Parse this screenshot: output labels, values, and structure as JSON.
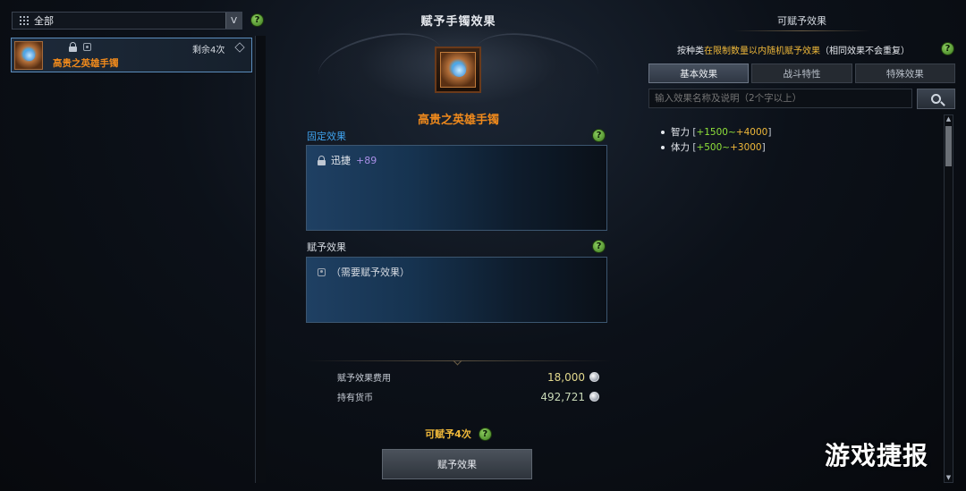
{
  "left": {
    "filter_label": "全部",
    "dropdown_arrow": "V",
    "help": "?",
    "item": {
      "name": "高贵之英雄手镯",
      "remaining": "剩余4次",
      "icon": "bracelet-icon"
    }
  },
  "center": {
    "title": "赋予手镯效果",
    "item_name": "高贵之英雄手镯",
    "fixed_label": "固定效果",
    "fixed_effect_name": "迅捷",
    "fixed_effect_value": "+89",
    "grant_label": "赋予效果",
    "grant_placeholder": "（需要赋予效果）",
    "cost_label": "赋予效果费用",
    "cost_value": "18,000",
    "currency_label": "持有货币",
    "currency_value": "492,721",
    "remaining": "可赋予4次",
    "grant_button": "赋予效果",
    "help": "?"
  },
  "right": {
    "title": "可赋予效果",
    "desc_pre": "按种类",
    "desc_hl": "在限制数量以内随机赋予效果",
    "desc_post": "（相同效果不会重复）",
    "tabs": [
      {
        "label": "基本效果",
        "active": true
      },
      {
        "label": "战斗特性",
        "active": false
      },
      {
        "label": "特殊效果",
        "active": false
      }
    ],
    "search_placeholder": "输入效果名称及说明（2个字以上）",
    "effects": [
      {
        "name": "智力",
        "min": "+1500",
        "sep": "~",
        "max": "+4000"
      },
      {
        "name": "体力",
        "min": "+500",
        "sep": "~",
        "max": "+3000"
      }
    ],
    "help": "?"
  },
  "watermark": "游戏捷报",
  "colors": {
    "accent_orange": "#f08a1c",
    "accent_blue": "#3fa3ee",
    "gold": "#f0b93a",
    "green": "#8fe03a",
    "purple_value": "#a98fe6"
  }
}
